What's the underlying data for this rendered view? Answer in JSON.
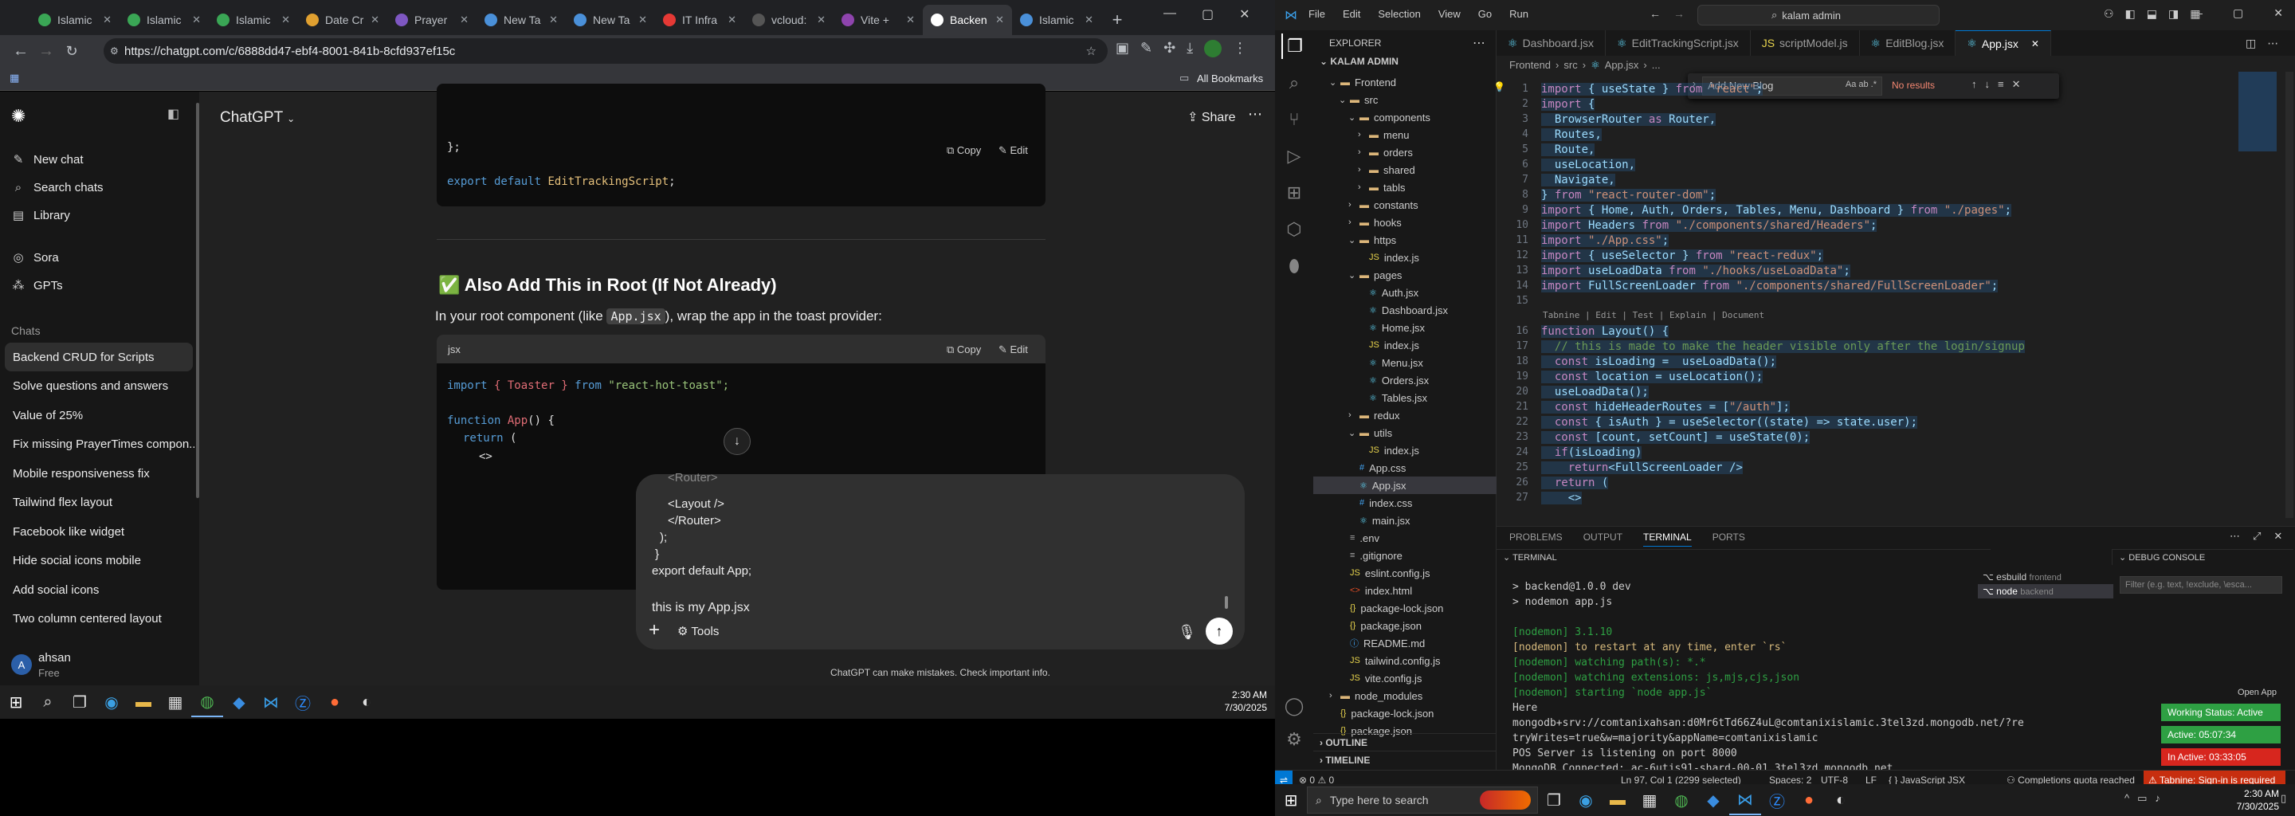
{
  "browser": {
    "tabs": [
      "Islamic",
      "Islamic",
      "Islamic",
      "Date Cr",
      "Prayer",
      "New Ta",
      "New Ta",
      "IT Infra",
      "vcloud:",
      "Vite +",
      "Backen",
      "Islamic"
    ],
    "active_tab_index": 10,
    "url": "https://chatgpt.com/c/6888dd47-ebf4-8001-841b-8cfd937ef15c",
    "bookmarks_label": "All Bookmarks"
  },
  "chatgpt": {
    "model": "ChatGPT",
    "share_label": "Share",
    "nav": {
      "new_chat": "New chat",
      "search": "Search chats",
      "library": "Library",
      "sora": "Sora",
      "gpts": "GPTs",
      "chats_heading": "Chats"
    },
    "chats": [
      "Backend CRUD for Scripts",
      "Solve questions and answers",
      "Value of 25%",
      "Fix missing PrayerTimes compon...",
      "Mobile responsiveness fix",
      "Tailwind flex layout",
      "Facebook like widget",
      "Hide social icons mobile",
      "Add social icons",
      "Two column centered layout"
    ],
    "user": {
      "initials": "A",
      "name": "ahsan",
      "plan": "Free"
    },
    "code1": {
      "line1": "};",
      "line2": "export default EditTrackingScript;",
      "copy": "Copy",
      "edit": "Edit"
    },
    "heading": "Also Add This in Root (If Not Already)",
    "heading_emoji": "✅",
    "para_before": "In your root component (like",
    "para_code": "App.jsx",
    "para_after": "), wrap the app in the toast provider:",
    "code2": {
      "lang": "jsx",
      "copy": "Copy",
      "edit": "Edit",
      "import_kw": "import",
      "import_id": "{ Toaster }",
      "from_kw": "from",
      "import_src": "\"react-hot-toast\";",
      "fn_kw": "function",
      "fn_name": "App",
      "fn_rest": "() {",
      "return_kw": "return",
      "return_rest": "(",
      "frag": "<>"
    },
    "composer": {
      "lines": [
        "<Router>",
        "<Layout />",
        "</Router>",
        ");",
        "}",
        "export default App;"
      ],
      "last_line": "this is my App.jsx",
      "plus": "+",
      "tools": "Tools"
    },
    "disclaimer": "ChatGPT can make mistakes. Check important info."
  },
  "taskbar_left": {
    "time": "2:30 AM",
    "date": "7/30/2025"
  },
  "vscode": {
    "menu": [
      "File",
      "Edit",
      "Selection",
      "View",
      "Go",
      "Run"
    ],
    "search": "kalam admin",
    "explorer_title": "EXPLORER",
    "root": "KALAM ADMIN",
    "tree": [
      {
        "name": "Frontend",
        "depth": 1,
        "type": "folder",
        "open": true
      },
      {
        "name": "src",
        "depth": 2,
        "type": "folder",
        "open": true
      },
      {
        "name": "components",
        "depth": 3,
        "type": "folder",
        "open": true
      },
      {
        "name": "menu",
        "depth": 4,
        "type": "folder",
        "open": false
      },
      {
        "name": "orders",
        "depth": 4,
        "type": "folder",
        "open": false
      },
      {
        "name": "shared",
        "depth": 4,
        "type": "folder",
        "open": false
      },
      {
        "name": "tabls",
        "depth": 4,
        "type": "folder",
        "open": false
      },
      {
        "name": "constants",
        "depth": 3,
        "type": "folder",
        "open": false
      },
      {
        "name": "hooks",
        "depth": 3,
        "type": "folder",
        "open": false
      },
      {
        "name": "https",
        "depth": 3,
        "type": "folder",
        "open": true
      },
      {
        "name": "index.js",
        "depth": 4,
        "type": "js"
      },
      {
        "name": "pages",
        "depth": 3,
        "type": "folder",
        "open": true
      },
      {
        "name": "Auth.jsx",
        "depth": 4,
        "type": "jsx"
      },
      {
        "name": "Dashboard.jsx",
        "depth": 4,
        "type": "jsx"
      },
      {
        "name": "Home.jsx",
        "depth": 4,
        "type": "jsx"
      },
      {
        "name": "index.js",
        "depth": 4,
        "type": "js"
      },
      {
        "name": "Menu.jsx",
        "depth": 4,
        "type": "jsx"
      },
      {
        "name": "Orders.jsx",
        "depth": 4,
        "type": "jsx"
      },
      {
        "name": "Tables.jsx",
        "depth": 4,
        "type": "jsx"
      },
      {
        "name": "redux",
        "depth": 3,
        "type": "folder",
        "open": false
      },
      {
        "name": "utils",
        "depth": 3,
        "type": "folder",
        "open": true
      },
      {
        "name": "index.js",
        "depth": 4,
        "type": "js"
      },
      {
        "name": "App.css",
        "depth": 3,
        "type": "css"
      },
      {
        "name": "App.jsx",
        "depth": 3,
        "type": "jsx",
        "selected": true
      },
      {
        "name": "index.css",
        "depth": 3,
        "type": "css"
      },
      {
        "name": "main.jsx",
        "depth": 3,
        "type": "jsx"
      },
      {
        "name": ".env",
        "depth": 2,
        "type": "file"
      },
      {
        "name": ".gitignore",
        "depth": 2,
        "type": "file"
      },
      {
        "name": "eslint.config.js",
        "depth": 2,
        "type": "js"
      },
      {
        "name": "index.html",
        "depth": 2,
        "type": "html"
      },
      {
        "name": "package-lock.json",
        "depth": 2,
        "type": "json"
      },
      {
        "name": "package.json",
        "depth": 2,
        "type": "json"
      },
      {
        "name": "README.md",
        "depth": 2,
        "type": "md"
      },
      {
        "name": "tailwind.config.js",
        "depth": 2,
        "type": "js"
      },
      {
        "name": "vite.config.js",
        "depth": 2,
        "type": "js"
      },
      {
        "name": "node_modules",
        "depth": 1,
        "type": "folder",
        "open": false
      },
      {
        "name": "package-lock.json",
        "depth": 1,
        "type": "json"
      },
      {
        "name": "package.json",
        "depth": 1,
        "type": "json"
      }
    ],
    "outline": "OUTLINE",
    "timeline": "TIMELINE",
    "tabs": [
      "Dashboard.jsx",
      "EditTrackingScript.jsx",
      "scriptModel.js",
      "EditBlog.jsx",
      "App.jsx"
    ],
    "active_tab": "App.jsx",
    "breadcrumb": [
      "Frontend",
      "src",
      "App.jsx",
      "..."
    ],
    "find": {
      "value": "Add New Blog",
      "result": "No results"
    },
    "code_lines": [
      {
        "n": "1",
        "t": "import { useState } from \"react\";"
      },
      {
        "n": "2",
        "t": "import {"
      },
      {
        "n": "3",
        "t": "  BrowserRouter as Router,"
      },
      {
        "n": "4",
        "t": "  Routes,"
      },
      {
        "n": "5",
        "t": "  Route,"
      },
      {
        "n": "6",
        "t": "  useLocation,"
      },
      {
        "n": "7",
        "t": "  Navigate,"
      },
      {
        "n": "8",
        "t": "} from \"react-router-dom\";"
      },
      {
        "n": "9",
        "t": "import { Home, Auth, Orders, Tables, Menu, Dashboard } from \"./pages\";"
      },
      {
        "n": "10",
        "t": "import Headers from \"./components/shared/Headers\";"
      },
      {
        "n": "11",
        "t": "import \"./App.css\";"
      },
      {
        "n": "12",
        "t": "import { useSelector } from \"react-redux\";"
      },
      {
        "n": "13",
        "t": "import useLoadData from \"./hooks/useLoadData\";"
      },
      {
        "n": "14",
        "t": "import FullScreenLoader from \"./components/shared/FullScreenLoader\";"
      },
      {
        "n": "15",
        "t": ""
      },
      {
        "n": "",
        "t": "Tabnine | Edit | Test | Explain | Document"
      },
      {
        "n": "16",
        "t": "function Layout() {"
      },
      {
        "n": "17",
        "t": "  // this is made to make the header visible only after the login/signup"
      },
      {
        "n": "18",
        "t": "  const isLoading =  useLoadData();"
      },
      {
        "n": "19",
        "t": "  const location = useLocation();"
      },
      {
        "n": "20",
        "t": "  useLoadData();"
      },
      {
        "n": "21",
        "t": "  const hideHeaderRoutes = [\"/auth\"];"
      },
      {
        "n": "22",
        "t": "  const { isAuth } = useSelector((state) => state.user);"
      },
      {
        "n": "23",
        "t": "  const [count, setCount] = useState(0);"
      },
      {
        "n": "24",
        "t": "  if(isLoading)"
      },
      {
        "n": "25",
        "t": "    return<FullScreenLoader />"
      },
      {
        "n": "26",
        "t": "  return ("
      },
      {
        "n": "27",
        "t": "    <>"
      }
    ],
    "panel_tabs": [
      "PROBLEMS",
      "OUTPUT",
      "TERMINAL",
      "PORTS"
    ],
    "active_panel_tab": "TERMINAL",
    "terminal_label": "TERMINAL",
    "terminal_lines": [
      "> backend@1.0.0 dev",
      "> nodemon app.js",
      "",
      "[nodemon] 3.1.10",
      "[nodemon] to restart at any time, enter `rs`",
      "[nodemon] watching path(s): *.*",
      "[nodemon] watching extensions: js,mjs,cjs,json",
      "[nodemon] starting `node app.js`",
      "Here",
      "mongodb+srv://comtanixahsan:d0Mr6tTd66Z4uL@comtanixislamic.3tel3zd.mongodb.net/?re",
      "tryWrites=true&w=majority&appName=comtanixislamic",
      "POS Server is listening on port 8000",
      "MongoDB Connected: ac-6utjs91-shard-00-01.3tel3zd.mongodb.net"
    ],
    "terminals": [
      {
        "name": "esbuild",
        "tag": "frontend"
      },
      {
        "name": "node",
        "tag": "backend"
      }
    ],
    "debug_console": "DEBUG CONSOLE",
    "debug_filter": "Filter (e.g. text, !exclude, \\esca...",
    "open_app": "Open App",
    "working_status": "Working Status: Active",
    "active_time": "Active: 05:07:34",
    "inactive_time": "In Active: 03:33:05",
    "status": {
      "errors": "0",
      "warnings": "0",
      "position": "Ln 97, Col 1 (2299 selected)",
      "spaces": "Spaces: 2",
      "encoding": "UTF-8",
      "eol": "LF",
      "lang": "JavaScript JSX",
      "quota": "Completions quota reached",
      "tabnine": "Tabnine: Sign-in is required"
    }
  },
  "taskbar_right": {
    "search_placeholder": "Type here to search",
    "time": "2:30 AM",
    "date": "7/30/2025"
  },
  "colors": {
    "accent": "#0078d4",
    "status_green": "#2ea043",
    "status_red": "#d7261e",
    "code_string": "#ce9178",
    "code_keyword": "#569cd6",
    "code_var": "#9cdcfe",
    "code_fn": "#dcdcaa"
  }
}
